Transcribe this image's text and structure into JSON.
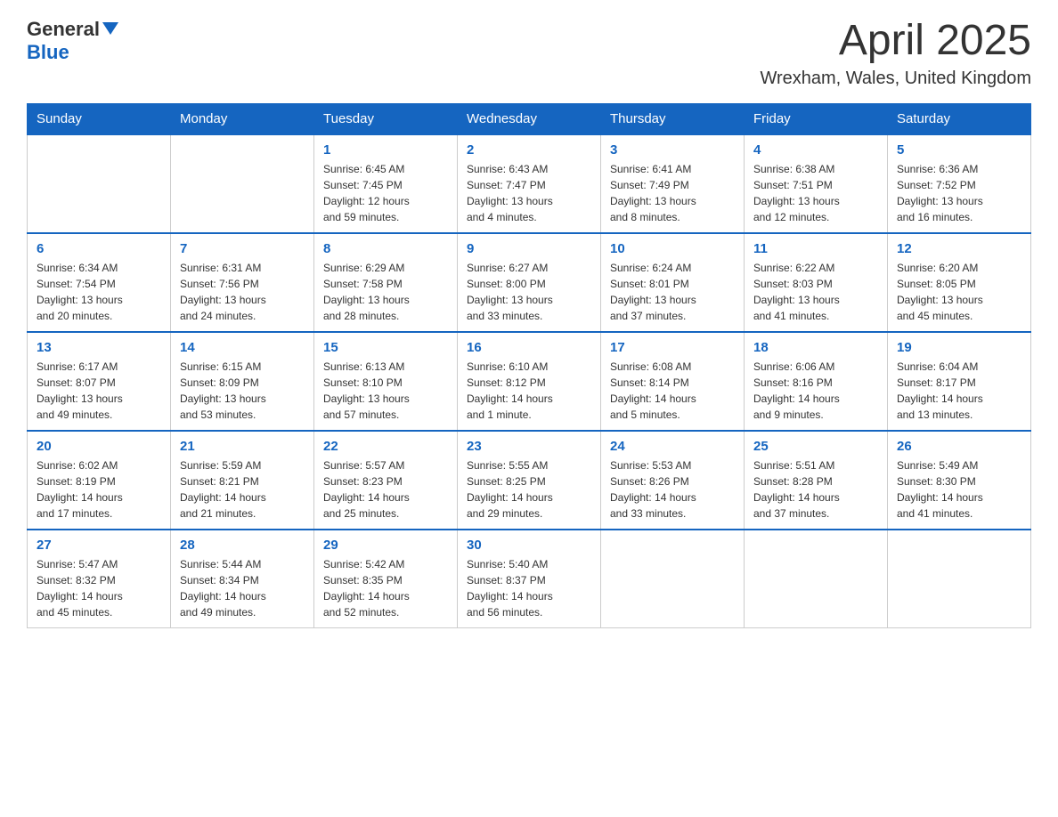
{
  "header": {
    "logo_general": "General",
    "logo_blue": "Blue",
    "month_title": "April 2025",
    "location": "Wrexham, Wales, United Kingdom"
  },
  "days_of_week": [
    "Sunday",
    "Monday",
    "Tuesday",
    "Wednesday",
    "Thursday",
    "Friday",
    "Saturday"
  ],
  "weeks": [
    [
      {
        "day": "",
        "info": ""
      },
      {
        "day": "",
        "info": ""
      },
      {
        "day": "1",
        "info": "Sunrise: 6:45 AM\nSunset: 7:45 PM\nDaylight: 12 hours\nand 59 minutes."
      },
      {
        "day": "2",
        "info": "Sunrise: 6:43 AM\nSunset: 7:47 PM\nDaylight: 13 hours\nand 4 minutes."
      },
      {
        "day": "3",
        "info": "Sunrise: 6:41 AM\nSunset: 7:49 PM\nDaylight: 13 hours\nand 8 minutes."
      },
      {
        "day": "4",
        "info": "Sunrise: 6:38 AM\nSunset: 7:51 PM\nDaylight: 13 hours\nand 12 minutes."
      },
      {
        "day": "5",
        "info": "Sunrise: 6:36 AM\nSunset: 7:52 PM\nDaylight: 13 hours\nand 16 minutes."
      }
    ],
    [
      {
        "day": "6",
        "info": "Sunrise: 6:34 AM\nSunset: 7:54 PM\nDaylight: 13 hours\nand 20 minutes."
      },
      {
        "day": "7",
        "info": "Sunrise: 6:31 AM\nSunset: 7:56 PM\nDaylight: 13 hours\nand 24 minutes."
      },
      {
        "day": "8",
        "info": "Sunrise: 6:29 AM\nSunset: 7:58 PM\nDaylight: 13 hours\nand 28 minutes."
      },
      {
        "day": "9",
        "info": "Sunrise: 6:27 AM\nSunset: 8:00 PM\nDaylight: 13 hours\nand 33 minutes."
      },
      {
        "day": "10",
        "info": "Sunrise: 6:24 AM\nSunset: 8:01 PM\nDaylight: 13 hours\nand 37 minutes."
      },
      {
        "day": "11",
        "info": "Sunrise: 6:22 AM\nSunset: 8:03 PM\nDaylight: 13 hours\nand 41 minutes."
      },
      {
        "day": "12",
        "info": "Sunrise: 6:20 AM\nSunset: 8:05 PM\nDaylight: 13 hours\nand 45 minutes."
      }
    ],
    [
      {
        "day": "13",
        "info": "Sunrise: 6:17 AM\nSunset: 8:07 PM\nDaylight: 13 hours\nand 49 minutes."
      },
      {
        "day": "14",
        "info": "Sunrise: 6:15 AM\nSunset: 8:09 PM\nDaylight: 13 hours\nand 53 minutes."
      },
      {
        "day": "15",
        "info": "Sunrise: 6:13 AM\nSunset: 8:10 PM\nDaylight: 13 hours\nand 57 minutes."
      },
      {
        "day": "16",
        "info": "Sunrise: 6:10 AM\nSunset: 8:12 PM\nDaylight: 14 hours\nand 1 minute."
      },
      {
        "day": "17",
        "info": "Sunrise: 6:08 AM\nSunset: 8:14 PM\nDaylight: 14 hours\nand 5 minutes."
      },
      {
        "day": "18",
        "info": "Sunrise: 6:06 AM\nSunset: 8:16 PM\nDaylight: 14 hours\nand 9 minutes."
      },
      {
        "day": "19",
        "info": "Sunrise: 6:04 AM\nSunset: 8:17 PM\nDaylight: 14 hours\nand 13 minutes."
      }
    ],
    [
      {
        "day": "20",
        "info": "Sunrise: 6:02 AM\nSunset: 8:19 PM\nDaylight: 14 hours\nand 17 minutes."
      },
      {
        "day": "21",
        "info": "Sunrise: 5:59 AM\nSunset: 8:21 PM\nDaylight: 14 hours\nand 21 minutes."
      },
      {
        "day": "22",
        "info": "Sunrise: 5:57 AM\nSunset: 8:23 PM\nDaylight: 14 hours\nand 25 minutes."
      },
      {
        "day": "23",
        "info": "Sunrise: 5:55 AM\nSunset: 8:25 PM\nDaylight: 14 hours\nand 29 minutes."
      },
      {
        "day": "24",
        "info": "Sunrise: 5:53 AM\nSunset: 8:26 PM\nDaylight: 14 hours\nand 33 minutes."
      },
      {
        "day": "25",
        "info": "Sunrise: 5:51 AM\nSunset: 8:28 PM\nDaylight: 14 hours\nand 37 minutes."
      },
      {
        "day": "26",
        "info": "Sunrise: 5:49 AM\nSunset: 8:30 PM\nDaylight: 14 hours\nand 41 minutes."
      }
    ],
    [
      {
        "day": "27",
        "info": "Sunrise: 5:47 AM\nSunset: 8:32 PM\nDaylight: 14 hours\nand 45 minutes."
      },
      {
        "day": "28",
        "info": "Sunrise: 5:44 AM\nSunset: 8:34 PM\nDaylight: 14 hours\nand 49 minutes."
      },
      {
        "day": "29",
        "info": "Sunrise: 5:42 AM\nSunset: 8:35 PM\nDaylight: 14 hours\nand 52 minutes."
      },
      {
        "day": "30",
        "info": "Sunrise: 5:40 AM\nSunset: 8:37 PM\nDaylight: 14 hours\nand 56 minutes."
      },
      {
        "day": "",
        "info": ""
      },
      {
        "day": "",
        "info": ""
      },
      {
        "day": "",
        "info": ""
      }
    ]
  ]
}
